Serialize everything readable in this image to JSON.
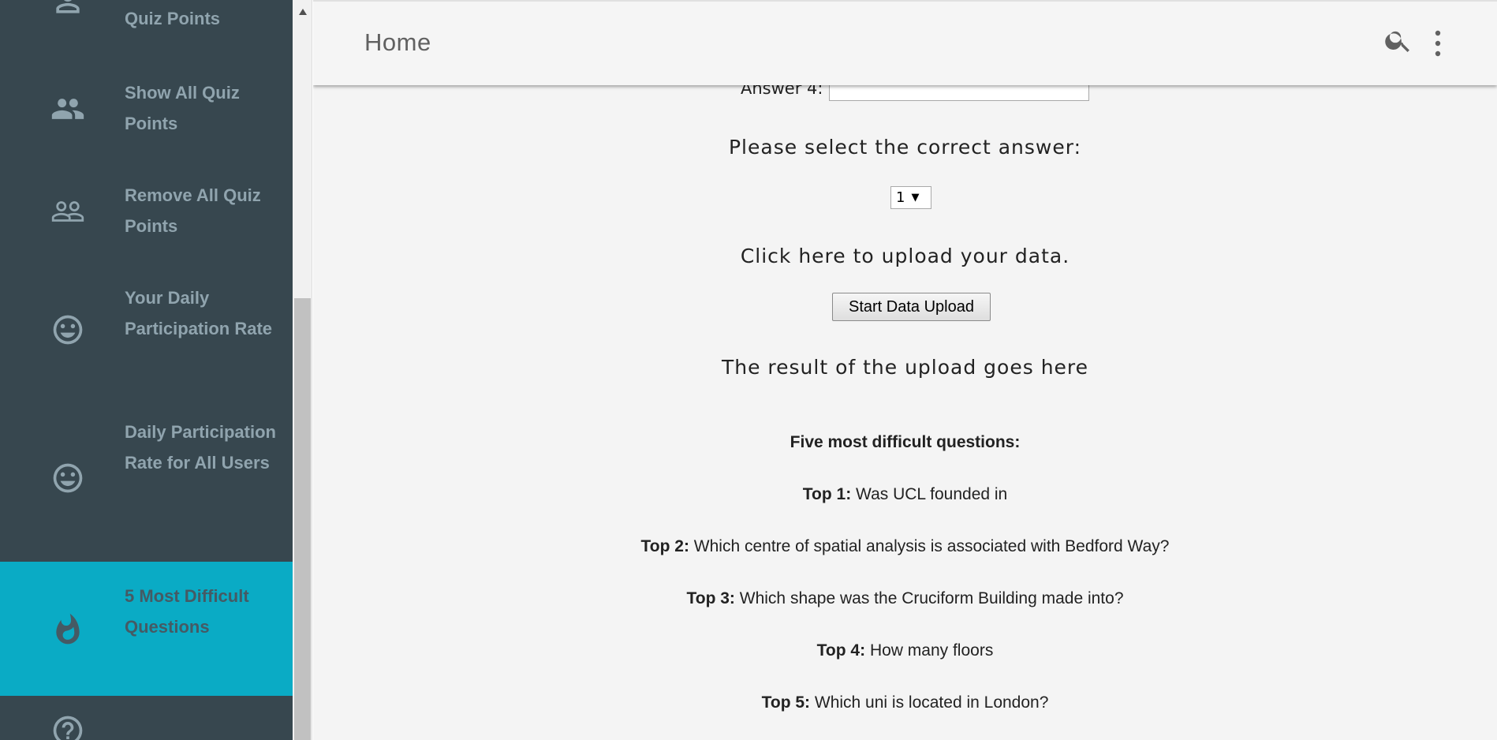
{
  "sidebar": {
    "items": [
      {
        "label": "Quiz Points",
        "icon": "person-icon"
      },
      {
        "label": "Show All Quiz Points",
        "icon": "people-icon"
      },
      {
        "label": "Remove All Quiz Points",
        "icon": "people-outline-icon"
      },
      {
        "label": "Your Daily Participation Rate",
        "icon": "smiley-icon"
      },
      {
        "label": "Daily Participation Rate for All Users",
        "icon": "smiley-icon"
      },
      {
        "label": "5 Most Difficult Questions",
        "icon": "fire-icon",
        "active": true
      },
      {
        "label": "",
        "icon": "help-icon"
      }
    ]
  },
  "header": {
    "title": "Home"
  },
  "form": {
    "answer4_label": "Answer 4:",
    "answer4_value": "",
    "select_prompt": "Please select the correct answer:",
    "selected_answer": "1",
    "upload_prompt": "Click here to upload your data.",
    "upload_button": "Start Data Upload",
    "upload_result": "The result of the upload goes here"
  },
  "difficult": {
    "heading": "Five most difficult questions:",
    "questions": [
      {
        "label": "Top 1:",
        "text": "Was UCL founded in"
      },
      {
        "label": "Top 2:",
        "text": "Which centre of spatial analysis is associated with Bedford Way?"
      },
      {
        "label": "Top 3:",
        "text": "Which shape was the Cruciform Building made into?"
      },
      {
        "label": "Top 4:",
        "text": "How many floors"
      },
      {
        "label": "Top 5:",
        "text": "Which uni is located in London?"
      }
    ]
  },
  "colors": {
    "sidebar_bg": "#37474f",
    "active_bg": "#0aabc5",
    "sidebar_text": "#90a4ae"
  }
}
